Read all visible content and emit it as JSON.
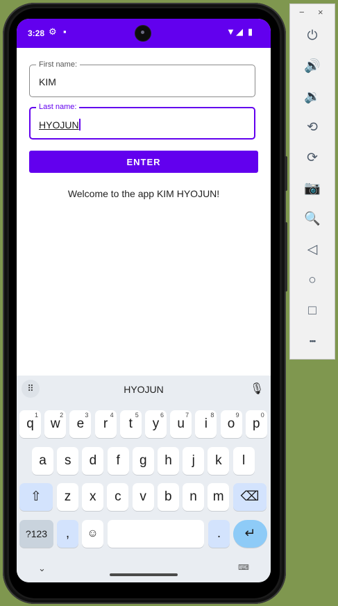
{
  "status_bar": {
    "time": "3:28",
    "left_icons": [
      "settings-icon",
      "sd-card-icon"
    ],
    "right_icons": [
      "wifi-icon",
      "signal-icon",
      "battery-icon"
    ],
    "color": "#6200ee"
  },
  "form": {
    "first_name": {
      "label": "First name:",
      "value": "KIM"
    },
    "last_name": {
      "label": "Last name:",
      "value": "HYOJUN"
    },
    "enter_button": "ENTER",
    "welcome_message": "Welcome to the app KIM HYOJUN!"
  },
  "keyboard": {
    "suggestion": "HYOJUN",
    "row1": [
      {
        "k": "q",
        "n": "1"
      },
      {
        "k": "w",
        "n": "2"
      },
      {
        "k": "e",
        "n": "3"
      },
      {
        "k": "r",
        "n": "4"
      },
      {
        "k": "t",
        "n": "5"
      },
      {
        "k": "y",
        "n": "6"
      },
      {
        "k": "u",
        "n": "7"
      },
      {
        "k": "i",
        "n": "8"
      },
      {
        "k": "o",
        "n": "9"
      },
      {
        "k": "p",
        "n": "0"
      }
    ],
    "row2": [
      "a",
      "s",
      "d",
      "f",
      "g",
      "h",
      "j",
      "k",
      "l"
    ],
    "row3": [
      "z",
      "x",
      "c",
      "v",
      "b",
      "n",
      "m"
    ],
    "symbols_key": "?123",
    "comma_key": ",",
    "period_key": ".",
    "shift_glyph": "⇧",
    "backspace_glyph": "⌫",
    "emoji_glyph": "☺",
    "enter_glyph": "↵",
    "hide_glyph": "⌄",
    "switch_glyph": "⌨"
  },
  "toolbar": {
    "minimize": "−",
    "close": "×",
    "buttons": [
      {
        "icon": "power-icon",
        "glyph": "⏻"
      },
      {
        "icon": "volume-up-icon",
        "glyph": "🔊"
      },
      {
        "icon": "volume-down-icon",
        "glyph": "🔉"
      },
      {
        "icon": "rotate-left-icon",
        "glyph": "⟲"
      },
      {
        "icon": "rotate-right-icon",
        "glyph": "⟳"
      },
      {
        "icon": "camera-icon",
        "glyph": "📷"
      },
      {
        "icon": "zoom-icon",
        "glyph": "🔍"
      },
      {
        "icon": "back-icon",
        "glyph": "◁"
      },
      {
        "icon": "home-icon",
        "glyph": "○"
      },
      {
        "icon": "overview-icon",
        "glyph": "□"
      },
      {
        "icon": "more-icon",
        "glyph": "•••"
      }
    ]
  }
}
